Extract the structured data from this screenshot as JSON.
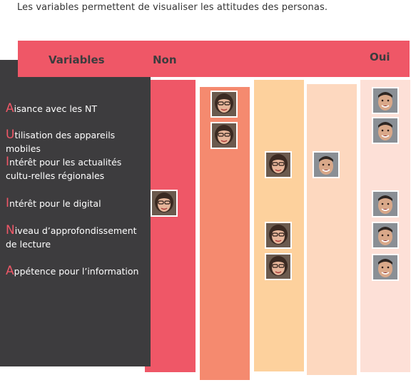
{
  "intro": "Les variables permettent de visualiser les attitudes des personas.",
  "header": {
    "variables": "Variables",
    "non": "Non",
    "oui": "Oui"
  },
  "variables": [
    {
      "initial": "A",
      "rest": "isance avec les NT"
    },
    {
      "initial": "U",
      "rest": "tilisation des appareils mobiles"
    },
    {
      "initial": "I",
      "rest": "ntérêt pour les actualités cultu-relles régionales"
    },
    {
      "initial": "I",
      "rest": "ntérêt pour le digital"
    },
    {
      "initial": "N",
      "rest": "iveau d’approfondissement de lecture"
    },
    {
      "initial": "A",
      "rest": "ppétence pour l’information"
    }
  ],
  "colors": {
    "dark": "#3d3c3e",
    "accent": "#ef5767",
    "scale": [
      "#ef5767",
      "#f58a6f",
      "#fdd19d",
      "#fdd8bf",
      "#fde0d7"
    ]
  },
  "personas": {
    "woman": "persona-woman-avatar",
    "man": "persona-man-avatar"
  }
}
